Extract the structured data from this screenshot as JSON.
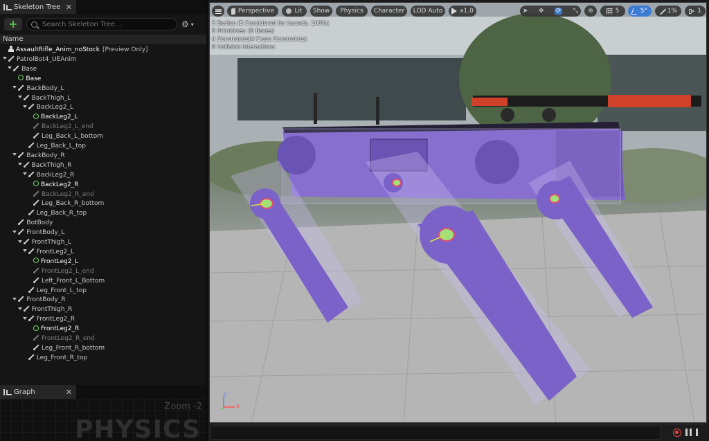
{
  "skeleton_panel": {
    "tab_label": "Skeleton Tree",
    "search_placeholder": "Search Skeleton Tree...",
    "column_header": "Name",
    "rows": [
      {
        "label": "AssaultRifle_Anim_noStock",
        "suffix": "[Preview Only]",
        "depth": 0,
        "icon": "mesh",
        "arrow": false,
        "style": "bright"
      },
      {
        "label": "PatrolBot4_UEAnim",
        "suffix": "",
        "depth": 0,
        "icon": "bone",
        "arrow": true,
        "style": "normal"
      },
      {
        "label": "Base",
        "suffix": "",
        "depth": 1,
        "icon": "bone",
        "arrow": true,
        "style": "normal"
      },
      {
        "label": "Base",
        "suffix": "",
        "depth": 2,
        "icon": "body",
        "arrow": false,
        "style": "bright"
      },
      {
        "label": "BackBody_L",
        "suffix": "",
        "depth": 2,
        "icon": "bone",
        "arrow": true,
        "style": "normal"
      },
      {
        "label": "BackThigh_L",
        "suffix": "",
        "depth": 3,
        "icon": "bone",
        "arrow": true,
        "style": "normal"
      },
      {
        "label": "BackLeg2_L",
        "suffix": "",
        "depth": 4,
        "icon": "bone",
        "arrow": true,
        "style": "normal"
      },
      {
        "label": "BackLeg2_L",
        "suffix": "",
        "depth": 5,
        "icon": "body",
        "arrow": false,
        "style": "bright"
      },
      {
        "label": "BackLeg2_L_end",
        "suffix": "",
        "depth": 5,
        "icon": "bone",
        "arrow": false,
        "style": "dim"
      },
      {
        "label": "Leg_Back_L_bottom",
        "suffix": "",
        "depth": 5,
        "icon": "bone",
        "arrow": false,
        "style": "normal"
      },
      {
        "label": "Leg_Back_L_top",
        "suffix": "",
        "depth": 4,
        "icon": "bone",
        "arrow": false,
        "style": "normal"
      },
      {
        "label": "BackBody_R",
        "suffix": "",
        "depth": 2,
        "icon": "bone",
        "arrow": true,
        "style": "normal"
      },
      {
        "label": "BackThigh_R",
        "suffix": "",
        "depth": 3,
        "icon": "bone",
        "arrow": true,
        "style": "normal"
      },
      {
        "label": "BackLeg2_R",
        "suffix": "",
        "depth": 4,
        "icon": "bone",
        "arrow": true,
        "style": "normal"
      },
      {
        "label": "BackLeg2_R",
        "suffix": "",
        "depth": 5,
        "icon": "body",
        "arrow": false,
        "style": "bright"
      },
      {
        "label": "BackLeg2_R_end",
        "suffix": "",
        "depth": 5,
        "icon": "bone",
        "arrow": false,
        "style": "dim"
      },
      {
        "label": "Leg_Back_R_bottom",
        "suffix": "",
        "depth": 5,
        "icon": "bone",
        "arrow": false,
        "style": "normal"
      },
      {
        "label": "Leg_Back_R_top",
        "suffix": "",
        "depth": 4,
        "icon": "bone",
        "arrow": false,
        "style": "normal"
      },
      {
        "label": "BotBody",
        "suffix": "",
        "depth": 2,
        "icon": "bone",
        "arrow": false,
        "style": "normal"
      },
      {
        "label": "FrontBody_L",
        "suffix": "",
        "depth": 2,
        "icon": "bone",
        "arrow": true,
        "style": "normal"
      },
      {
        "label": "FrontThigh_L",
        "suffix": "",
        "depth": 3,
        "icon": "bone",
        "arrow": true,
        "style": "normal"
      },
      {
        "label": "FrontLeg2_L",
        "suffix": "",
        "depth": 4,
        "icon": "bone",
        "arrow": true,
        "style": "normal"
      },
      {
        "label": "FrontLeg2_L",
        "suffix": "",
        "depth": 5,
        "icon": "body",
        "arrow": false,
        "style": "bright"
      },
      {
        "label": "FrontLeg2_L_end",
        "suffix": "",
        "depth": 5,
        "icon": "bone",
        "arrow": false,
        "style": "dim"
      },
      {
        "label": "Left_Front_L_Bottom",
        "suffix": "",
        "depth": 5,
        "icon": "bone",
        "arrow": false,
        "style": "normal"
      },
      {
        "label": "Leg_Front_L_top",
        "suffix": "",
        "depth": 4,
        "icon": "bone",
        "arrow": false,
        "style": "normal"
      },
      {
        "label": "FrontBody_R",
        "suffix": "",
        "depth": 2,
        "icon": "bone",
        "arrow": true,
        "style": "normal"
      },
      {
        "label": "FrontThigh_R",
        "suffix": "",
        "depth": 3,
        "icon": "bone",
        "arrow": true,
        "style": "normal"
      },
      {
        "label": "FrontLeg2_R",
        "suffix": "",
        "depth": 4,
        "icon": "bone",
        "arrow": true,
        "style": "normal"
      },
      {
        "label": "FrontLeg2_R",
        "suffix": "",
        "depth": 5,
        "icon": "body",
        "arrow": false,
        "style": "bright"
      },
      {
        "label": "FrontLeg2_R_end",
        "suffix": "",
        "depth": 5,
        "icon": "bone",
        "arrow": false,
        "style": "dim"
      },
      {
        "label": "Leg_Front_R_bottom",
        "suffix": "",
        "depth": 5,
        "icon": "bone",
        "arrow": false,
        "style": "normal"
      },
      {
        "label": "Leg_Front_R_top",
        "suffix": "",
        "depth": 4,
        "icon": "bone",
        "arrow": false,
        "style": "normal"
      }
    ]
  },
  "graph_panel": {
    "tab_label": "Graph",
    "zoom_label": "Zoom -2",
    "watermark": "PHYSICS"
  },
  "viewport": {
    "toolbar": {
      "perspective": "Perspective",
      "lit": "Lit",
      "show": "Show",
      "physics": "Physics",
      "character": "Character",
      "lod": "LOD Auto",
      "speed": "x1.0",
      "grid_snap": "5",
      "angle_snap": "5°",
      "scale_snap": "1%",
      "camera_speed": "1"
    },
    "stats": [
      "5 Bodies (5 Considered for bounds, 100%)",
      "5 Primitives: (5 Boxes)",
      "4 Constraints(4 Cross Constraints)",
      "0 Collision Interactions"
    ],
    "axis_z": "Z",
    "axis_x": "X"
  },
  "colors": {
    "accent": "#3c7bd3",
    "add_green": "#52c34e",
    "body_purple": "#7b62c9",
    "record_red": "#e44444"
  }
}
